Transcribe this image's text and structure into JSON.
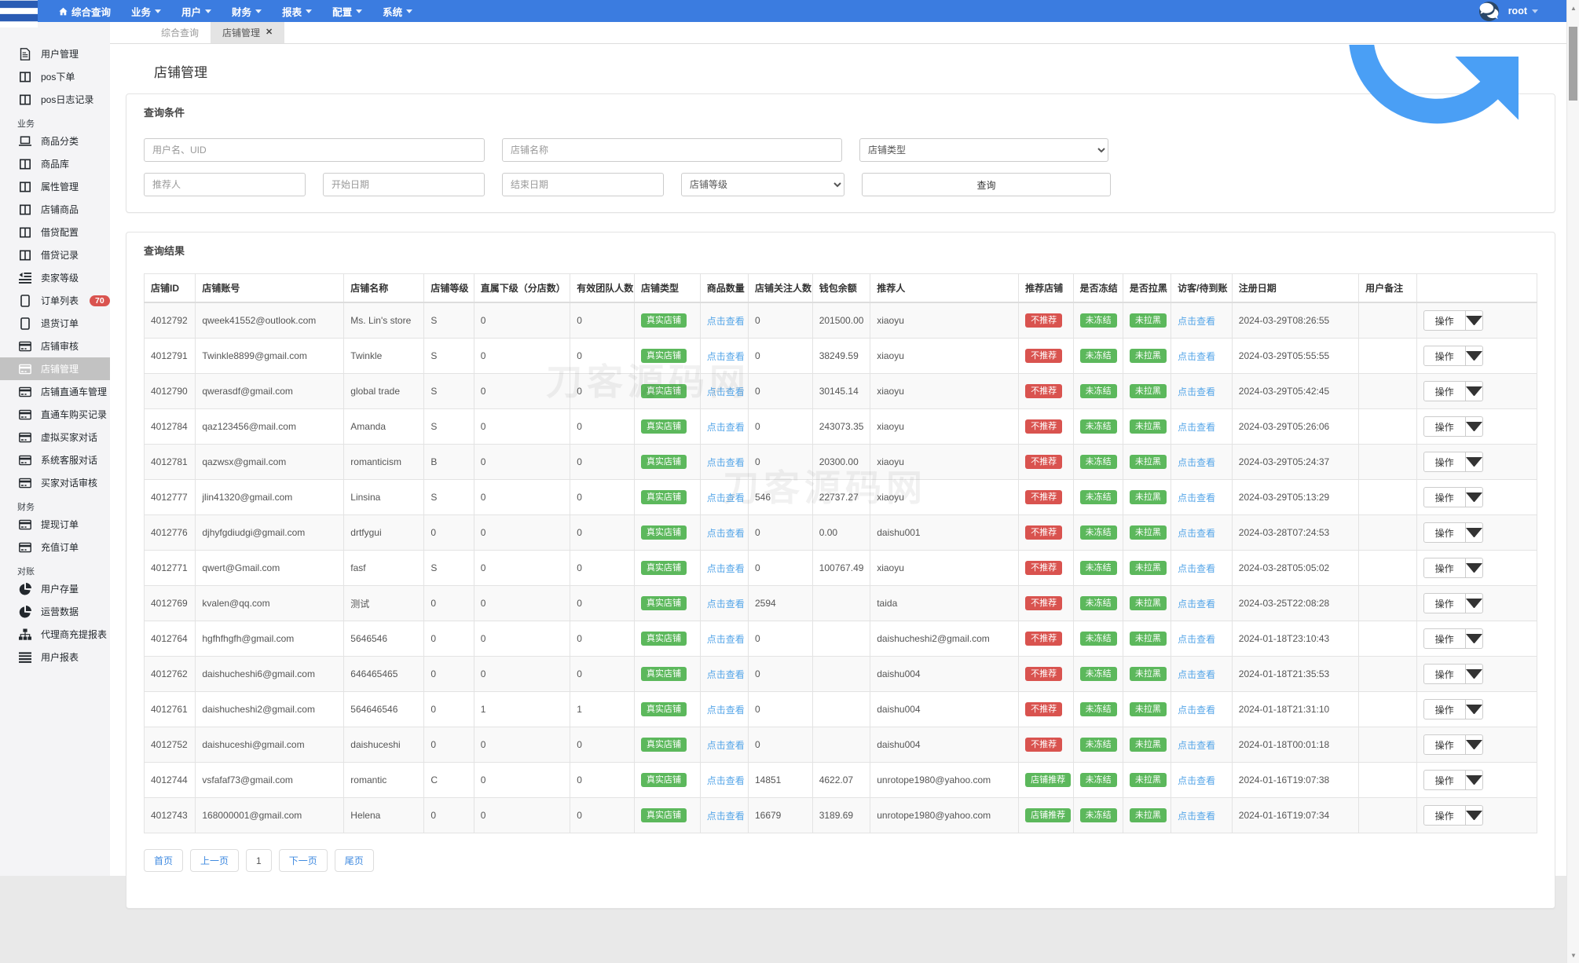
{
  "theme": {
    "navbar_bg": "#3b7ce0",
    "navbar_brand_bg": "#2a5cb4",
    "success": "#5cb85c",
    "danger": "#d9534f",
    "link": "#54a5e8",
    "sidebar_bg": "#f4f4f6",
    "active_item_bg": "#c2c2c2"
  },
  "navbar": {
    "items": [
      {
        "label": "综合查询",
        "icon": "home",
        "caret": false
      },
      {
        "label": "业务",
        "caret": true
      },
      {
        "label": "用户",
        "caret": true
      },
      {
        "label": "财务",
        "caret": true
      },
      {
        "label": "报表",
        "caret": true
      },
      {
        "label": "配置",
        "caret": true
      },
      {
        "label": "系统",
        "caret": true
      }
    ],
    "user": "root"
  },
  "sidebar": {
    "items": [
      {
        "type": "item",
        "label": "用户管理",
        "icon": "file"
      },
      {
        "type": "item",
        "label": "pos下单",
        "icon": "columns"
      },
      {
        "type": "item",
        "label": "pos日志记录",
        "icon": "columns"
      },
      {
        "type": "section",
        "label": "业务"
      },
      {
        "type": "item",
        "label": "商品分类",
        "icon": "laptop"
      },
      {
        "type": "item",
        "label": "商品库",
        "icon": "columns"
      },
      {
        "type": "item",
        "label": "属性管理",
        "icon": "columns"
      },
      {
        "type": "item",
        "label": "店铺商品",
        "icon": "columns"
      },
      {
        "type": "item",
        "label": "借贷配置",
        "icon": "columns"
      },
      {
        "type": "item",
        "label": "借贷记录",
        "icon": "columns"
      },
      {
        "type": "item",
        "label": "卖家等级",
        "icon": "indent"
      },
      {
        "type": "item",
        "label": "订单列表",
        "icon": "tablet",
        "badge": "70"
      },
      {
        "type": "item",
        "label": "退货订单",
        "icon": "tablet"
      },
      {
        "type": "item",
        "label": "店铺审核",
        "icon": "credit-card"
      },
      {
        "type": "item",
        "label": "店铺管理",
        "icon": "credit-card",
        "active": true
      },
      {
        "type": "item",
        "label": "店铺直通车管理",
        "icon": "credit-card"
      },
      {
        "type": "item",
        "label": "直通车购买记录",
        "icon": "credit-card"
      },
      {
        "type": "item",
        "label": "虚拟买家对话",
        "icon": "credit-card"
      },
      {
        "type": "item",
        "label": "系统客服对话",
        "icon": "credit-card"
      },
      {
        "type": "item",
        "label": "买家对话审核",
        "icon": "credit-card"
      },
      {
        "type": "section",
        "label": "财务"
      },
      {
        "type": "item",
        "label": "提现订单",
        "icon": "credit-card"
      },
      {
        "type": "item",
        "label": "充值订单",
        "icon": "credit-card"
      },
      {
        "type": "section",
        "label": "对账"
      },
      {
        "type": "item",
        "label": "用户存量",
        "icon": "pie"
      },
      {
        "type": "item",
        "label": "运营数据",
        "icon": "pie"
      },
      {
        "type": "item",
        "label": "代理商充提报表",
        "icon": "sitemap"
      },
      {
        "type": "item",
        "label": "用户报表",
        "icon": "lines"
      }
    ]
  },
  "tabs": [
    {
      "label": "综合查询",
      "active": false,
      "closable": false
    },
    {
      "label": "店铺管理",
      "active": true,
      "closable": true
    }
  ],
  "page": {
    "title": "店铺管理"
  },
  "filter": {
    "title": "查询条件",
    "username_placeholder": "用户名、UID",
    "shop_name_placeholder": "店铺名称",
    "shop_type_label": "店铺类型",
    "referrer_placeholder": "推荐人",
    "start_date_placeholder": "开始日期",
    "end_date_placeholder": "结束日期",
    "shop_level_label": "店铺等级",
    "query_button": "查询"
  },
  "results": {
    "title": "查询结果",
    "columns": [
      "店铺ID",
      "店铺账号",
      "店铺名称",
      "店铺等级",
      "直属下级（分店数）",
      "有效团队人数",
      "店铺类型",
      "商品数量",
      "店铺关注人数",
      "钱包余额",
      "推荐人",
      "推荐店铺",
      "是否冻结",
      "是否拉黑",
      "访客/待到账",
      "注册日期",
      "用户备注",
      ""
    ],
    "labels": {
      "shop_type": "真实店铺",
      "view_link": "点击查看",
      "not_frozen": "未冻结",
      "not_blacklisted": "未拉黑",
      "action": "操作"
    },
    "rows": [
      {
        "id": "4012792",
        "account": "qweek41552@outlook.com",
        "name": "Ms. Lin's store",
        "level": "S",
        "direct": "0",
        "team": "0",
        "followers": "0",
        "balance": "201500.00",
        "referrer": "xiaoyu",
        "recommend": "不推荐",
        "recommend_type": "danger",
        "date": "2024-03-29T08:26:55",
        "remark": ""
      },
      {
        "id": "4012791",
        "account": "Twinkle8899@gmail.com",
        "name": "Twinkle",
        "level": "S",
        "direct": "0",
        "team": "0",
        "followers": "0",
        "balance": "38249.59",
        "referrer": "xiaoyu",
        "recommend": "不推荐",
        "recommend_type": "danger",
        "date": "2024-03-29T05:55:55",
        "remark": ""
      },
      {
        "id": "4012790",
        "account": "qwerasdf@gmail.com",
        "name": "global trade",
        "level": "S",
        "direct": "0",
        "team": "0",
        "followers": "0",
        "balance": "30145.14",
        "referrer": "xiaoyu",
        "recommend": "不推荐",
        "recommend_type": "danger",
        "date": "2024-03-29T05:42:45",
        "remark": ""
      },
      {
        "id": "4012784",
        "account": "qaz123456@mail.com",
        "name": "Amanda",
        "level": "S",
        "direct": "0",
        "team": "0",
        "followers": "0",
        "balance": "243073.35",
        "referrer": "xiaoyu",
        "recommend": "不推荐",
        "recommend_type": "danger",
        "date": "2024-03-29T05:26:06",
        "remark": ""
      },
      {
        "id": "4012781",
        "account": "qazwsx@gmail.com",
        "name": "romanticism",
        "level": "B",
        "direct": "0",
        "team": "0",
        "followers": "0",
        "balance": "20300.00",
        "referrer": "xiaoyu",
        "recommend": "不推荐",
        "recommend_type": "danger",
        "date": "2024-03-29T05:24:37",
        "remark": ""
      },
      {
        "id": "4012777",
        "account": "jlin41320@gmail.com",
        "name": "Linsina",
        "level": "S",
        "direct": "0",
        "team": "0",
        "followers": "546",
        "balance": "22737.27",
        "referrer": "xiaoyu",
        "recommend": "不推荐",
        "recommend_type": "danger",
        "date": "2024-03-29T05:13:29",
        "remark": ""
      },
      {
        "id": "4012776",
        "account": "djhyfgdiudgi@gmail.com",
        "name": "drtfygui",
        "level": "0",
        "direct": "0",
        "team": "0",
        "followers": "0",
        "balance": "0.00",
        "referrer": "daishu001",
        "recommend": "不推荐",
        "recommend_type": "danger",
        "date": "2024-03-28T07:24:53",
        "remark": ""
      },
      {
        "id": "4012771",
        "account": "qwert@Gmail.com",
        "name": "fasf",
        "level": "S",
        "direct": "0",
        "team": "0",
        "followers": "0",
        "balance": "100767.49",
        "referrer": "xiaoyu",
        "recommend": "不推荐",
        "recommend_type": "danger",
        "date": "2024-03-28T05:05:02",
        "remark": ""
      },
      {
        "id": "4012769",
        "account": "kvalen@qq.com",
        "name": "测试",
        "level": "0",
        "direct": "0",
        "team": "0",
        "followers": "2594",
        "balance": "",
        "referrer": "taida",
        "recommend": "不推荐",
        "recommend_type": "danger",
        "date": "2024-03-25T22:08:28",
        "remark": ""
      },
      {
        "id": "4012764",
        "account": "hgfhfhgfh@gmail.com",
        "name": "5646546",
        "level": "0",
        "direct": "0",
        "team": "0",
        "followers": "0",
        "balance": "",
        "referrer": "daishucheshi2@gmail.com",
        "recommend": "不推荐",
        "recommend_type": "danger",
        "date": "2024-01-18T23:10:43",
        "remark": ""
      },
      {
        "id": "4012762",
        "account": "daishucheshi6@gmail.com",
        "name": "646465465",
        "level": "0",
        "direct": "0",
        "team": "0",
        "followers": "0",
        "balance": "",
        "referrer": "daishu004",
        "recommend": "不推荐",
        "recommend_type": "danger",
        "date": "2024-01-18T21:35:53",
        "remark": ""
      },
      {
        "id": "4012761",
        "account": "daishucheshi2@gmail.com",
        "name": "564646546",
        "level": "0",
        "direct": "1",
        "team": "1",
        "followers": "0",
        "balance": "",
        "referrer": "daishu004",
        "recommend": "不推荐",
        "recommend_type": "danger",
        "date": "2024-01-18T21:31:10",
        "remark": ""
      },
      {
        "id": "4012752",
        "account": "daishuceshi@gmail.com",
        "name": "daishuceshi",
        "level": "0",
        "direct": "0",
        "team": "0",
        "followers": "0",
        "balance": "",
        "referrer": "daishu004",
        "recommend": "不推荐",
        "recommend_type": "danger",
        "date": "2024-01-18T00:01:18",
        "remark": ""
      },
      {
        "id": "4012744",
        "account": "vsfafaf73@gmail.com",
        "name": "romantic",
        "level": "C",
        "direct": "0",
        "team": "0",
        "followers": "14851",
        "balance": "4622.07",
        "referrer": "unrotope1980@yahoo.com",
        "recommend": "店铺推荐",
        "recommend_type": "success",
        "date": "2024-01-16T19:07:38",
        "remark": ""
      },
      {
        "id": "4012743",
        "account": "168000001@gmail.com",
        "name": "Helena",
        "level": "0",
        "direct": "0",
        "team": "0",
        "followers": "16679",
        "balance": "3189.69",
        "referrer": "unrotope1980@yahoo.com",
        "recommend": "店铺推荐",
        "recommend_type": "success",
        "date": "2024-01-16T19:07:34",
        "remark": ""
      }
    ],
    "pagination": [
      {
        "label": "首页",
        "current": false
      },
      {
        "label": "上一页",
        "current": false
      },
      {
        "label": "1",
        "current": true
      },
      {
        "label": "下一页",
        "current": false
      },
      {
        "label": "尾页",
        "current": false
      }
    ]
  },
  "watermark": "刀客源码网"
}
